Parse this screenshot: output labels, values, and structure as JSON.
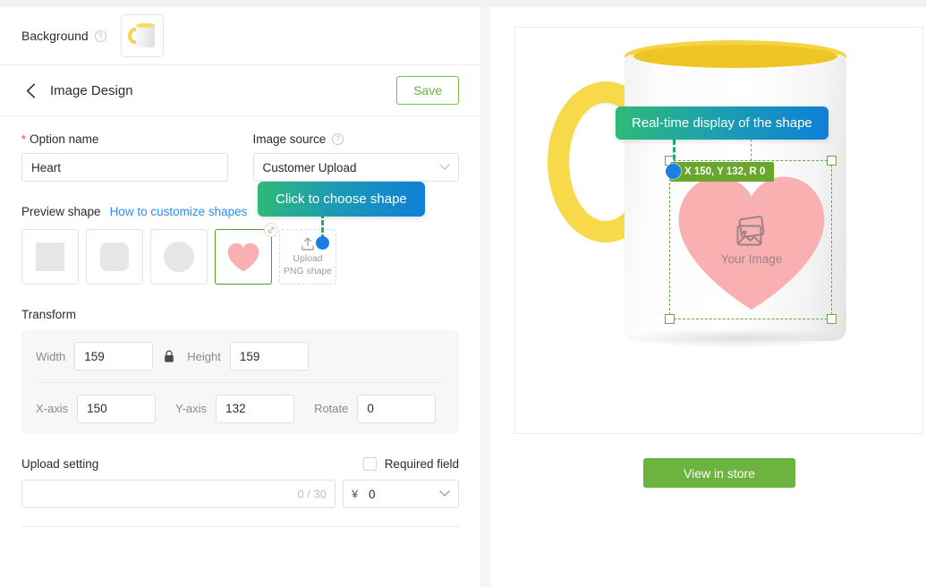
{
  "background": {
    "label": "Background",
    "help_icon": "question-icon",
    "thumbnail_alt": "mug-thumbnail"
  },
  "header": {
    "back_icon": "chevron-left-icon",
    "title": "Image Design",
    "save_label": "Save"
  },
  "form": {
    "option_name": {
      "label": "Option name",
      "required_marker": "*",
      "value": "Heart",
      "placeholder": "Option name"
    },
    "image_source": {
      "label": "Image source",
      "help_icon": "question-icon",
      "value": "Customer Upload",
      "caret_icon": "chevron-down-icon",
      "options": [
        "Customer Upload"
      ]
    }
  },
  "preview_shape": {
    "title": "Preview shape",
    "link": "How to customize shapes",
    "shapes": [
      {
        "name": "square",
        "selected": false
      },
      {
        "name": "rounded-square",
        "selected": false
      },
      {
        "name": "circle",
        "selected": false
      },
      {
        "name": "heart",
        "selected": true,
        "badge_icon": "expand-icon"
      }
    ],
    "upload": {
      "icon": "upload-icon",
      "line1": "Upload",
      "line2": "PNG shape"
    }
  },
  "transform": {
    "title": "Transform",
    "lock_icon": "lock-icon",
    "fields": {
      "width": {
        "label": "Width",
        "value": "159"
      },
      "height": {
        "label": "Height",
        "value": "159"
      },
      "x_axis": {
        "label": "X-axis",
        "value": "150"
      },
      "y_axis": {
        "label": "Y-axis",
        "value": "132"
      },
      "rotate": {
        "label": "Rotate",
        "value": "0"
      }
    }
  },
  "upload_setting": {
    "title": "Upload setting",
    "required_field_label": "Required field",
    "required_field_checked": false,
    "note": {
      "value": "",
      "placeholder": "",
      "counter": "0 / 30"
    },
    "price": {
      "currency": "¥",
      "value": "0",
      "caret_icon": "chevron-down-icon"
    }
  },
  "preview": {
    "tooltip_realtime": "Real-time display of the shape",
    "tooltip_choose": "Click to choose shape",
    "coord_badge": "X 150, Y 132, R 0",
    "placeholder_icon": "image-placeholder-icon",
    "placeholder_text": "Your Image",
    "view_in_store_label": "View in store"
  },
  "colors": {
    "accent_green": "#6cb33f",
    "save_green": "#62b337",
    "link_blue": "#2d8cf0",
    "badge_green": "#6aa52e",
    "selection_green": "#6aa84f",
    "heart_pink": "#f9b0b0",
    "mug_yellow": "#f5d43f",
    "dot_blue": "#1a7fe0",
    "required_red": "#f04134"
  }
}
